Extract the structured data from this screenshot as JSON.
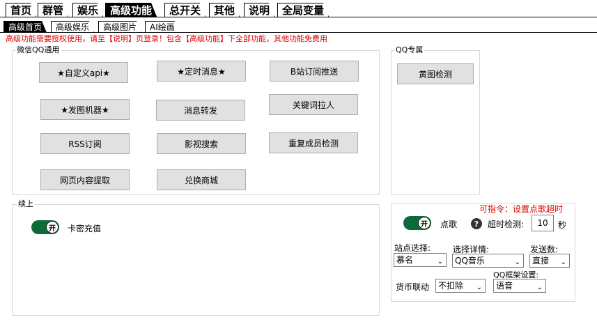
{
  "top_tabs": [
    "首页",
    "群管",
    "娱乐",
    "高级功能",
    "总开关",
    "其他",
    "说明",
    "全局变量"
  ],
  "sub_tabs": [
    "高级首页",
    "高级娱乐",
    "高级图片",
    "AI绘画"
  ],
  "notice": "高级功能需要授权使用，请至【说明】页登录！包含【高级功能】下全部功能，其他功能免费用",
  "wechat_group": {
    "title": "微信QQ通用",
    "buttons": [
      "★自定义api★",
      "★定时消息★",
      "B站订阅推送",
      "★发图机器★",
      "消息转发",
      "关键词拉人",
      "RSS订阅",
      "影视搜索",
      "重复成员检测",
      "网页内容提取",
      "兑换商城"
    ]
  },
  "qq_group": {
    "title": "QQ专属",
    "buttons": [
      "黄图检测"
    ]
  },
  "continue_group": {
    "title": "续上",
    "toggle_text": "开",
    "toggle_label": "卡密充值"
  },
  "music_group": {
    "hint": "可指令：设置点歌超时",
    "toggle_text": "开",
    "toggle_label": "点歌",
    "help_text": "?",
    "timeout_label": "超时检测:",
    "timeout_value": "10",
    "timeout_unit": "秒",
    "site_label": "站点选择:",
    "site_value": "慕名",
    "detail_label": "选择详情:",
    "detail_value": "QQ音乐",
    "send_label": "发送数:",
    "send_value": "直接",
    "frame_label": "QQ框架设置:",
    "frame_value": "语音",
    "currency_label": "货币联动",
    "currency_value": "不扣除"
  }
}
